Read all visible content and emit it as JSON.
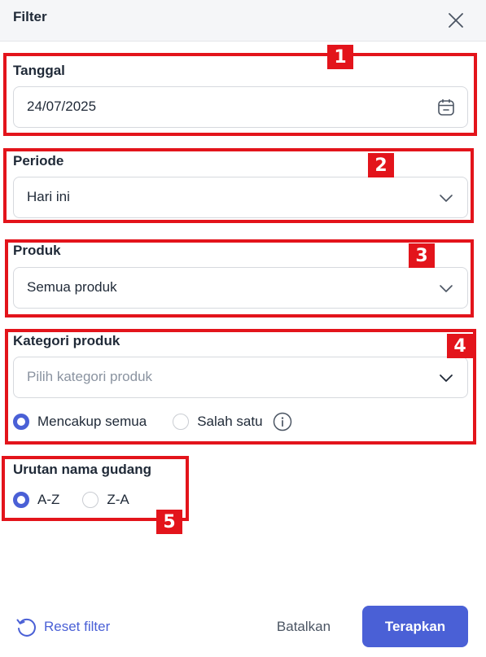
{
  "header": {
    "title": "Filter",
    "close_icon": "close-icon"
  },
  "tanggal": {
    "label": "Tanggal",
    "value": "24/07/2025",
    "icon": "calendar-icon"
  },
  "periode": {
    "label": "Periode",
    "value": "Hari ini",
    "icon": "chevron-down-icon"
  },
  "produk": {
    "label": "Produk",
    "value": "Semua produk",
    "icon": "chevron-down-icon"
  },
  "kategori": {
    "label": "Kategori produk",
    "placeholder": "Pilih kategori produk",
    "icon": "chevron-down-icon",
    "options": [
      {
        "label": "Mencakup semua",
        "checked": true
      },
      {
        "label": "Salah satu",
        "checked": false
      }
    ],
    "info_icon": "info-icon"
  },
  "urutan": {
    "label": "Urutan nama gudang",
    "options": [
      {
        "label": "A-Z",
        "checked": true
      },
      {
        "label": "Z-A",
        "checked": false
      }
    ]
  },
  "annotations": [
    "1",
    "2",
    "3",
    "4",
    "5"
  ],
  "footer": {
    "reset_label": "Reset filter",
    "cancel_label": "Batalkan",
    "apply_label": "Terapkan"
  },
  "colors": {
    "accent": "#4a60d6",
    "annotation": "#e3141b",
    "header_bg": "#f5f6f8"
  }
}
